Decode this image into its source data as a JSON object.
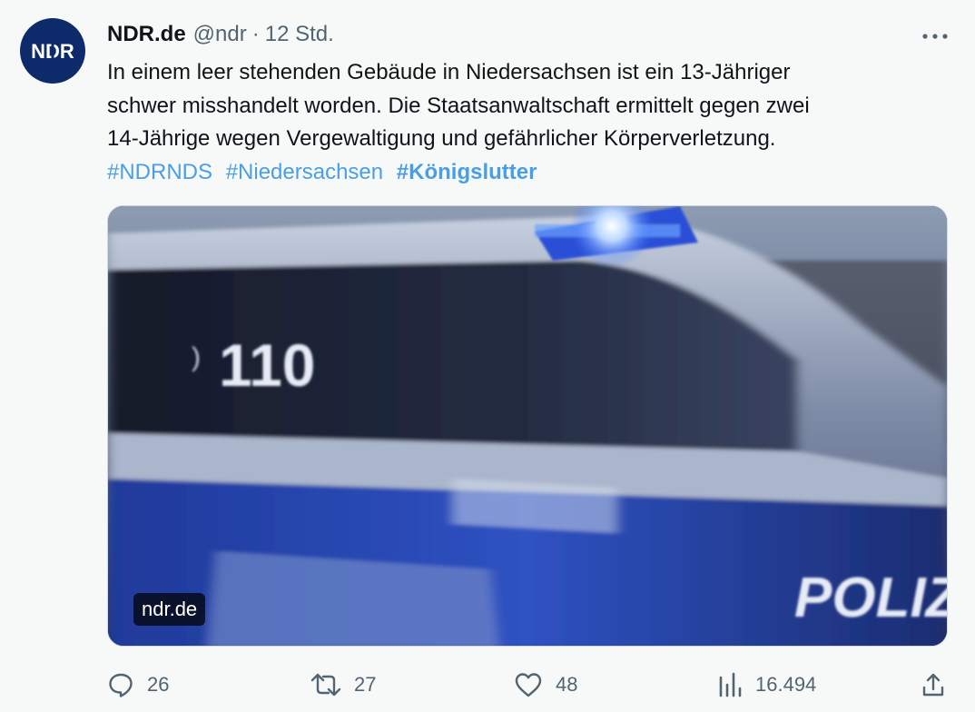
{
  "author": {
    "name": "NDR.de",
    "handle": "@ndr",
    "separator": "·",
    "time": "12 Std.",
    "avatar_text": "NDR"
  },
  "tweet": {
    "lines": [
      "In einem leer stehenden Gebäude in Niedersachsen ist ein 13-Jähriger",
      "schwer misshandelt worden. Die Staatsanwaltschaft ermittelt gegen zwei",
      "14-Jährige wegen Vergewaltigung und gefährlicher Körperverletzung."
    ],
    "hashtags": [
      "#NDRNDS",
      "#Niedersachsen",
      "#Königslutter"
    ]
  },
  "media": {
    "source": "ndr.de",
    "photo_text": {
      "emergency_number": "110",
      "police_label": "POLIZEI"
    },
    "colors": {
      "car_blue": "#2c47a8",
      "car_silver": "#c9d2e0"
    }
  },
  "actions": {
    "replies": "26",
    "retweets": "27",
    "likes": "48",
    "views": "16.494"
  },
  "icons": {
    "more": "more-icon",
    "reply": "reply-icon",
    "retweet": "retweet-icon",
    "like": "heart-icon",
    "views": "views-icon",
    "share": "share-icon"
  },
  "colors": {
    "hashtag": "#4a9ee6",
    "secondary_text": "#536471",
    "avatar_bg": "#0d2a6b"
  }
}
